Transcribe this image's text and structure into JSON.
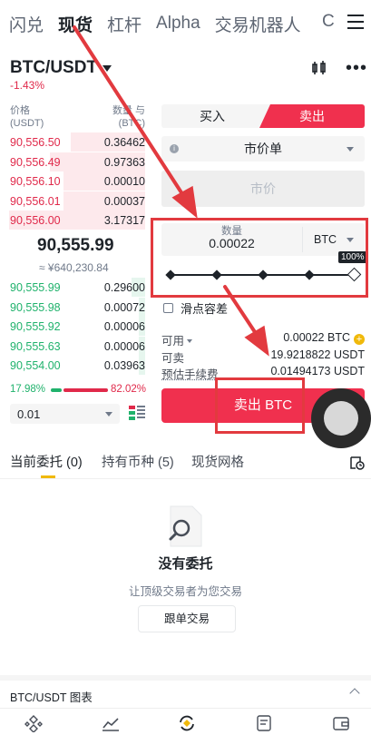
{
  "nav": {
    "tabs": [
      "闪兑",
      "现货",
      "杠杆",
      "Alpha",
      "交易机器人"
    ],
    "active_index": 1,
    "partial_tab": "C"
  },
  "pair": {
    "symbol": "BTC/USDT",
    "change": "-1.43%"
  },
  "orderbook": {
    "price_header": "价格",
    "price_unit": "(USDT)",
    "qty_header": "数量 与",
    "qty_unit": "(BTC)",
    "asks": [
      {
        "price": "90,556.50",
        "qty": "0.36462",
        "depth": 0.55
      },
      {
        "price": "90,556.49",
        "qty": "0.97363",
        "depth": 0.7
      },
      {
        "price": "90,556.10",
        "qty": "0.00010",
        "depth": 0.6
      },
      {
        "price": "90,556.01",
        "qty": "0.00037",
        "depth": 0.6
      },
      {
        "price": "90,556.00",
        "qty": "3.17317",
        "depth": 1.0
      }
    ],
    "last_price": "90,555.99",
    "last_price_cny": "≈ ¥640,230.84",
    "bids": [
      {
        "price": "90,555.99",
        "qty": "0.29600",
        "depth": 0.1
      },
      {
        "price": "90,555.98",
        "qty": "0.00072",
        "depth": 0.05
      },
      {
        "price": "90,555.92",
        "qty": "0.00006",
        "depth": 0.05
      },
      {
        "price": "90,555.63",
        "qty": "0.00006",
        "depth": 0.05
      },
      {
        "price": "90,554.00",
        "qty": "0.03963",
        "depth": 0.05
      }
    ],
    "buy_ratio": "17.98%",
    "sell_ratio": "82.02%",
    "depth_value": "0.01"
  },
  "trade": {
    "buy_label": "买入",
    "sell_label": "卖出",
    "order_type": "市价单",
    "price_placeholder": "市价",
    "qty_label": "数量",
    "qty_value": "0.00022",
    "qty_unit": "BTC",
    "slider_percent_label": "100%",
    "slider_fraction": 1.0,
    "slippage_label": "滑点容差",
    "available_label": "可用",
    "available_value": "0.00022 BTC",
    "sellable_label": "可卖",
    "sellable_value": "19.9218822 USDT",
    "fee_label": "预估手续费",
    "fee_value": "0.01494173 USDT",
    "submit_label": "卖出 BTC"
  },
  "orders_tabs": {
    "open_orders": "当前委托",
    "open_count": "(0)",
    "holdings": "持有币种",
    "holdings_count": "(5)",
    "grid": "现货网格"
  },
  "empty": {
    "title": "没有委托",
    "subtitle": "让顶级交易者为您交易",
    "button": "跟单交易"
  },
  "chart_bar": {
    "label": "BTC/USDT 图表"
  },
  "colors": {
    "red": "#f0304e",
    "green": "#20b26c",
    "annotation": "#e23a3f",
    "yellow": "#f0b90b"
  }
}
